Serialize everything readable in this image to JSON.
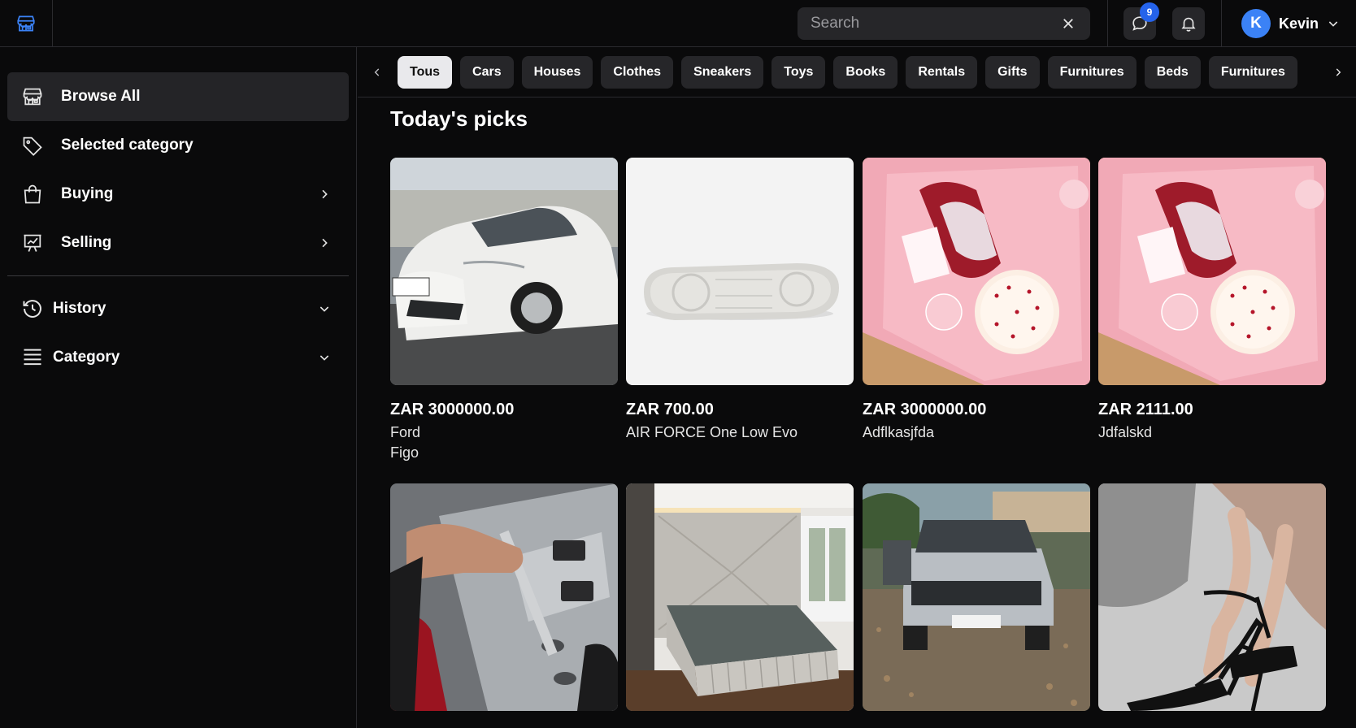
{
  "header": {
    "search_placeholder": "Search",
    "messages_badge": "9",
    "user_initial": "K",
    "user_name": "Kevin"
  },
  "sidebar": {
    "items": [
      {
        "label": "Browse All"
      },
      {
        "label": "Selected category"
      },
      {
        "label": "Buying"
      },
      {
        "label": "Selling"
      },
      {
        "label": "History"
      },
      {
        "label": "Category"
      }
    ]
  },
  "categories": {
    "active": "Tous",
    "items": [
      "Tous",
      "Cars",
      "Houses",
      "Clothes",
      "Sneakers",
      "Toys",
      "Books",
      "Rentals",
      "Gifts",
      "Furnitures",
      "Beds",
      "Furnitures"
    ]
  },
  "main": {
    "title": "Today's picks",
    "listings": [
      {
        "price": "ZAR 3000000.00",
        "lines": [
          "Ford",
          "Figo"
        ],
        "image": "white-hatchback-car"
      },
      {
        "price": "ZAR 700.00",
        "lines": [
          "AIR FORCE One Low Evo"
        ],
        "image": "sneaker-sole"
      },
      {
        "price": "ZAR 3000000.00",
        "lines": [
          "Adflkasjfda"
        ],
        "image": "birthday-gift-box"
      },
      {
        "price": "ZAR 2111.00",
        "lines": [
          "Jdfalskd"
        ],
        "image": "birthday-gift-box"
      },
      {
        "price": "",
        "lines": [],
        "image": "engine-spark-plug"
      },
      {
        "price": "",
        "lines": [],
        "image": "upholstered-bed"
      },
      {
        "price": "",
        "lines": [],
        "image": "silver-suv"
      },
      {
        "price": "",
        "lines": [],
        "image": "black-high-heels"
      }
    ]
  },
  "colors": {
    "background": "#0a0a0b",
    "surface": "#262629",
    "accent": "#2563eb",
    "active_pill": "#e9e9ec"
  }
}
